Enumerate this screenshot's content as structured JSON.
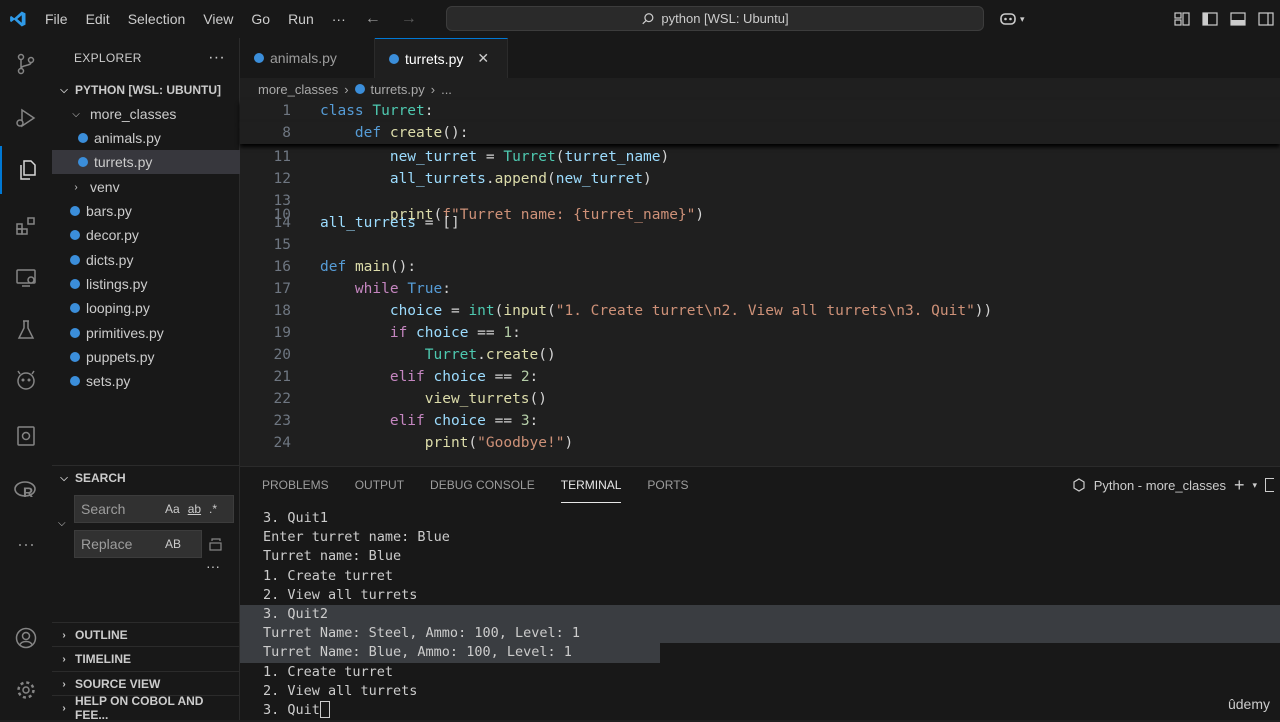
{
  "menu": [
    "File",
    "Edit",
    "Selection",
    "View",
    "Go",
    "Run",
    "···"
  ],
  "command_center": "python [WSL: Ubuntu]",
  "explorer": {
    "title": "EXPLORER",
    "workspace": "PYTHON [WSL: UBUNTU]",
    "folder": "more_classes",
    "items": [
      "animals.py",
      "turrets.py",
      "venv",
      "bars.py",
      "decor.py",
      "dicts.py",
      "listings.py",
      "looping.py",
      "primitives.py",
      "puppets.py",
      "sets.py"
    ]
  },
  "search": {
    "title": "SEARCH",
    "search_placeholder": "Search",
    "replace_placeholder": "Replace",
    "opt_case": "Aa",
    "opt_word": "ab",
    "opt_regex": ".*",
    "opt_preserve": "AB"
  },
  "sections": [
    "OUTLINE",
    "TIMELINE",
    "SOURCE VIEW",
    "HELP ON COBOL AND FEE..."
  ],
  "tabs": [
    {
      "label": "animals.py"
    },
    {
      "label": "turrets.py",
      "close": "✕"
    }
  ],
  "breadcrumb": {
    "folder": "more_classes",
    "file": "turrets.py",
    "more": "..."
  },
  "code_lines": {
    "l1": "1",
    "l8": "8",
    "l10": "10",
    "l11": "11",
    "l12": "12",
    "l13": "13",
    "l14": "14",
    "l15": "15",
    "l16": "16",
    "l17": "17",
    "l18": "18",
    "l19": "19",
    "l20": "20",
    "l21": "21",
    "l22": "22",
    "l23": "23",
    "l24": "24"
  },
  "panel": {
    "tabs": [
      "PROBLEMS",
      "OUTPUT",
      "DEBUG CONSOLE",
      "TERMINAL",
      "PORTS"
    ],
    "active_tab": "TERMINAL",
    "terminal_name": "Python - more_classes",
    "lines": [
      "3. Quit1",
      "Enter turret name: Blue",
      "Turret name: Blue",
      "1. Create turret",
      "2. View all turrets",
      "3. Quit2",
      "Turret Name: Steel, Ammo: 100, Level: 1",
      "Turret Name: Blue, Ammo: 100, Level: 1",
      "1. Create turret",
      "2. View all turrets",
      "3. Quit"
    ]
  },
  "watermark": "ûdemy",
  "colors": {
    "accent": "#0078d4",
    "background": "#1f1f1f",
    "sidebar": "#181818"
  }
}
